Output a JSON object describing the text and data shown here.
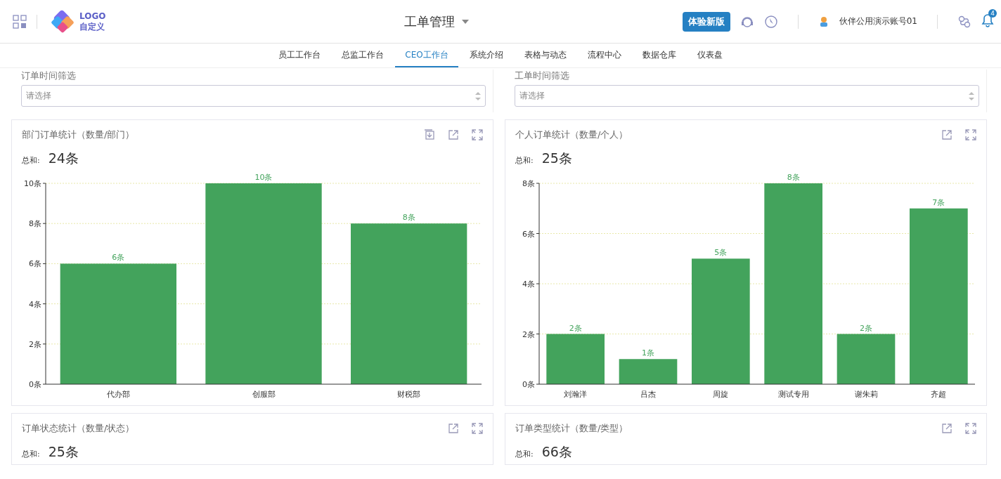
{
  "header": {
    "logo_text": "LOGO",
    "logo_subtext": "自定义",
    "title": "工单管理",
    "try_button": "体验新版",
    "account": "伙伴公用演示账号01",
    "notification_count": "4"
  },
  "nav": [
    {
      "label": "员工工作台",
      "selected": false
    },
    {
      "label": "总监工作台",
      "selected": false
    },
    {
      "label": "CEO工作台",
      "selected": true
    },
    {
      "label": "系统介绍",
      "selected": false
    },
    {
      "label": "表格与动态",
      "selected": false
    },
    {
      "label": "流程中心",
      "selected": false
    },
    {
      "label": "数据仓库",
      "selected": false
    },
    {
      "label": "仪表盘",
      "selected": false
    }
  ],
  "filters": [
    {
      "label": "订单时间筛选",
      "placeholder": "请选择"
    },
    {
      "label": "工单时间筛选",
      "placeholder": "请选择"
    }
  ],
  "cards": [
    {
      "title": "部门订单统计（数量/部门）",
      "download": true,
      "total_label": "总和:",
      "total": "24条",
      "chart_data": {
        "type": "bar",
        "categories": [
          "代办部",
          "创服部",
          "财税部"
        ],
        "series": [
          {
            "color": "#43a35c",
            "values": [
              6,
              10,
              8
            ]
          }
        ],
        "grid": true,
        "ylim": [
          0,
          10
        ],
        "yticks": [
          {
            "value": 0,
            "label": "0条"
          },
          {
            "value": 2,
            "label": "2条"
          },
          {
            "value": 4,
            "label": "4条"
          },
          {
            "value": 6,
            "label": "6条"
          },
          {
            "value": 8,
            "label": "8条"
          },
          {
            "value": 10,
            "label": "10条"
          }
        ],
        "value_labels": [
          "6条",
          "10条",
          "8条"
        ]
      }
    },
    {
      "title": "个人订单统计（数量/个人）",
      "download": false,
      "total_label": "总和:",
      "total": "25条",
      "chart_data": {
        "type": "bar",
        "categories": [
          "刘瀚洋",
          "吕杰",
          "周旋",
          "测试专用",
          "谢朱莉",
          "齐超"
        ],
        "series": [
          {
            "color": "#43a35c",
            "values": [
              2,
              1,
              5,
              8,
              2,
              7
            ]
          }
        ],
        "grid": true,
        "ylim": [
          0,
          8
        ],
        "yticks": [
          {
            "value": 0,
            "label": "0条"
          },
          {
            "value": 2,
            "label": "2条"
          },
          {
            "value": 4,
            "label": "4条"
          },
          {
            "value": 6,
            "label": "6条"
          },
          {
            "value": 8,
            "label": "8条"
          }
        ],
        "value_labels": [
          "2条",
          "1条",
          "5条",
          "8条",
          "2条",
          "7条"
        ]
      }
    },
    {
      "title": "订单状态统计（数量/状态）",
      "download": false,
      "total_label": "总和:",
      "total": "25条"
    },
    {
      "title": "订单类型统计（数量/类型）",
      "download": false,
      "total_label": "总和:",
      "total": "66条"
    }
  ]
}
